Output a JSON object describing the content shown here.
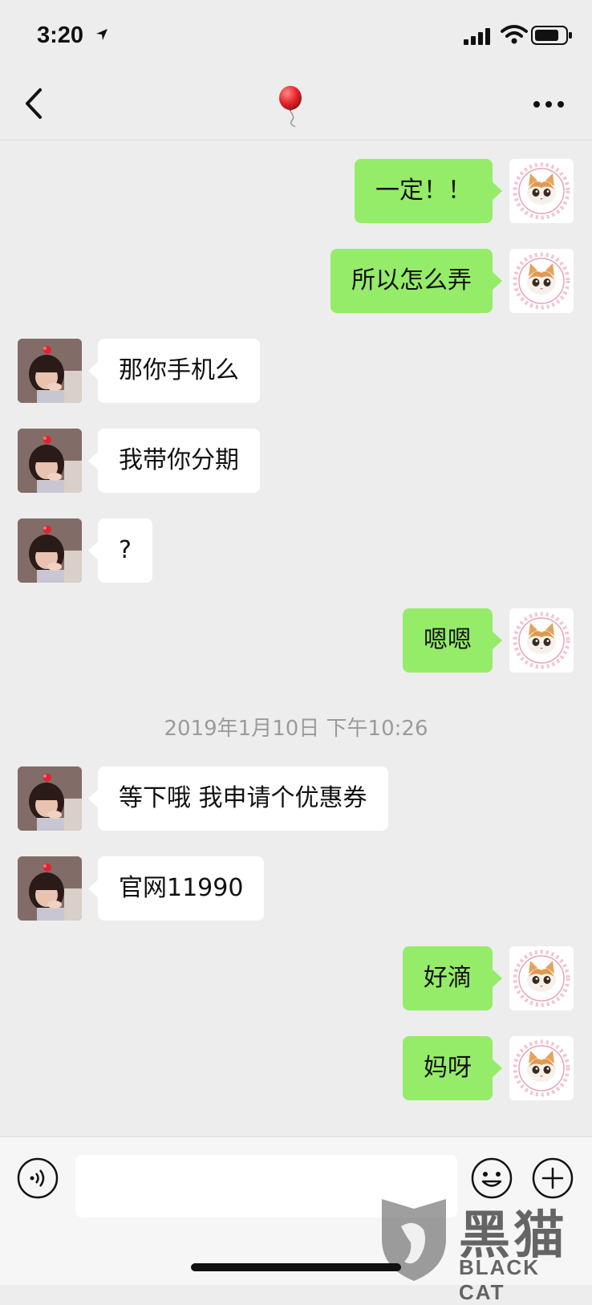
{
  "status_bar": {
    "time": "3:20"
  },
  "nav": {
    "title_icon": "balloon-icon"
  },
  "colors": {
    "bubble_me": "#95ec69",
    "bubble_them": "#ffffff",
    "background": "#ededed"
  },
  "messages": [
    {
      "from": "me",
      "text": "一定！！"
    },
    {
      "from": "me",
      "text": "所以怎么弄"
    },
    {
      "from": "them",
      "text": "那你手机么"
    },
    {
      "from": "them",
      "text": "我带你分期"
    },
    {
      "from": "them",
      "text": "?"
    },
    {
      "from": "me",
      "text": "嗯嗯"
    },
    {
      "timestamp": "2019年1月10日 下午10:26"
    },
    {
      "from": "them",
      "text": "等下哦 我申请个优惠券"
    },
    {
      "from": "them",
      "text": "官网11990"
    },
    {
      "from": "me",
      "text": "好滴"
    },
    {
      "from": "me",
      "text": "妈呀"
    }
  ],
  "input": {
    "value": ""
  },
  "watermark": {
    "cn": "黑猫",
    "en": "BLACK CAT"
  }
}
